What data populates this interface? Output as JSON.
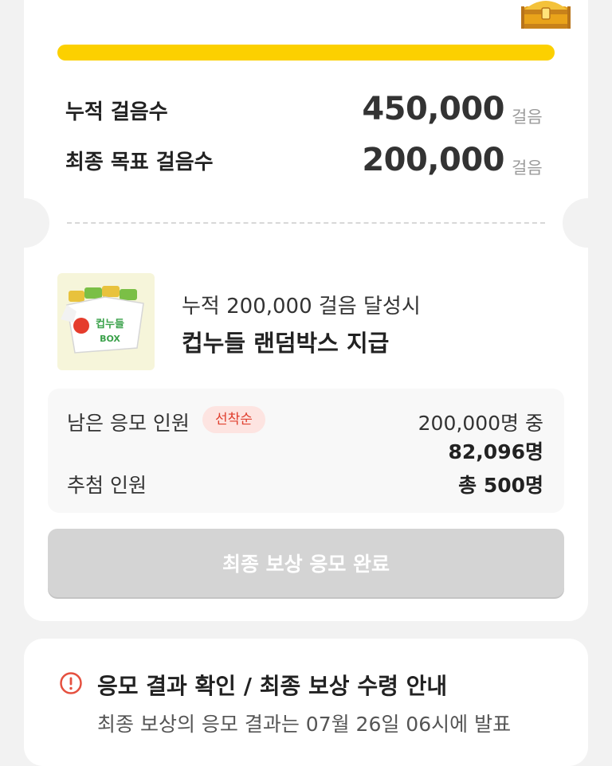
{
  "progress": {
    "fraction": 1.0,
    "color": "#fcd000"
  },
  "stats": {
    "accumulated_label": "누적 걸음수",
    "accumulated_value": "450,000",
    "accumulated_unit": "걸음",
    "goal_label": "최종 목표 걸음수",
    "goal_value": "200,000",
    "goal_unit": "걸음"
  },
  "reward": {
    "subtitle": "누적 200,000 걸음 달성시",
    "title": "컵누들 랜덤박스 지급",
    "image_icon": "cup-noodle-box-image",
    "box_text": "컵누들",
    "box_sub": "BOX"
  },
  "entries": {
    "remaining_label": "남은 응모 인원",
    "badge": "선착순",
    "remaining_total": "200,000명 중",
    "remaining_value": "82,096명",
    "winners_label": "추첨 인원",
    "winners_value": "총 500명"
  },
  "cta": {
    "label": "최종 보상 응모 완료"
  },
  "notice": {
    "icon": "alert-circle-icon",
    "title": "응모 결과 확인 / 최종 보상 수령 안내",
    "body": "최종 보상의 응모 결과는 07월 26일 06시에 발표"
  },
  "colors": {
    "accent_yellow": "#fcd000",
    "badge_bg": "#fde4e1",
    "badge_text": "#e0402f",
    "cta_disabled": "#d4d4d4",
    "alert_red": "#e5503f"
  }
}
